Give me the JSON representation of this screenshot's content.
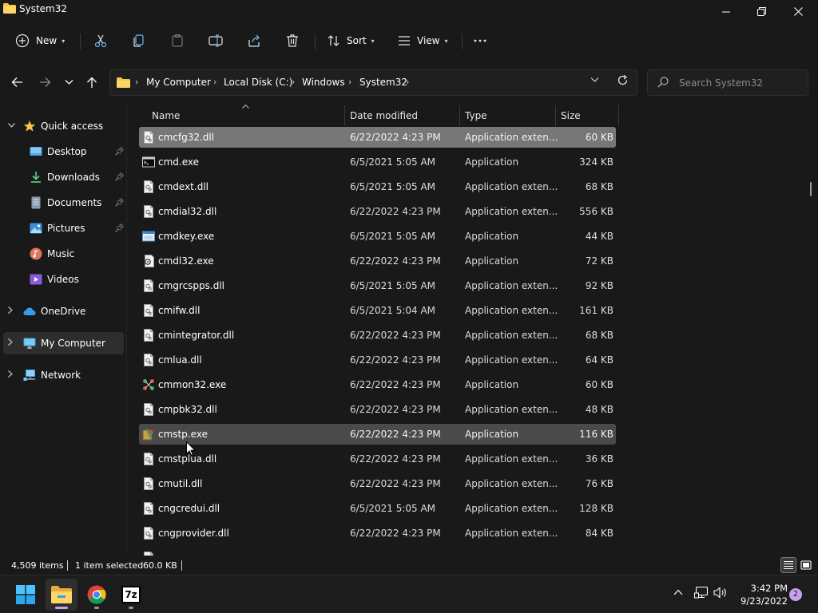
{
  "window": {
    "title": "System32",
    "minimize_icon": "minimize-icon",
    "restore_icon": "restore-icon",
    "close_icon": "close-icon"
  },
  "commandbar": {
    "new_label": "New",
    "sort_label": "Sort",
    "view_label": "View"
  },
  "address": {
    "crumbs": [
      "My Computer",
      "Local Disk (C:)",
      "Windows",
      "System32"
    ]
  },
  "search": {
    "placeholder": "Search System32"
  },
  "sidebar": {
    "items": [
      {
        "label": "Quick access",
        "icon": "star-icon"
      },
      {
        "label": "Desktop",
        "icon": "desktop-icon",
        "pinned": true
      },
      {
        "label": "Downloads",
        "icon": "download-icon",
        "pinned": true
      },
      {
        "label": "Documents",
        "icon": "documents-icon",
        "pinned": true
      },
      {
        "label": "Pictures",
        "icon": "pictures-icon",
        "pinned": true
      },
      {
        "label": "Music",
        "icon": "music-icon"
      },
      {
        "label": "Videos",
        "icon": "videos-icon"
      },
      {
        "label": "OneDrive",
        "icon": "cloud-icon"
      },
      {
        "label": "My Computer",
        "icon": "computer-icon",
        "selected": true
      },
      {
        "label": "Network",
        "icon": "network-icon"
      }
    ]
  },
  "columns": {
    "name": "Name",
    "date": "Date modified",
    "type": "Type",
    "size": "Size"
  },
  "files": [
    {
      "name": "cmcfg32.dll",
      "date": "6/22/2022 4:23 PM",
      "type": "Application exten...",
      "size": "60 KB",
      "icon": "dll-icon"
    },
    {
      "name": "cmd.exe",
      "date": "6/5/2021 5:05 AM",
      "type": "Application",
      "size": "324 KB",
      "icon": "console-icon"
    },
    {
      "name": "cmdext.dll",
      "date": "6/5/2021 5:05 AM",
      "type": "Application exten...",
      "size": "68 KB",
      "icon": "dll-icon"
    },
    {
      "name": "cmdial32.dll",
      "date": "6/22/2022 4:23 PM",
      "type": "Application exten...",
      "size": "556 KB",
      "icon": "dll-icon"
    },
    {
      "name": "cmdkey.exe",
      "date": "6/5/2021 5:05 AM",
      "type": "Application",
      "size": "44 KB",
      "icon": "app-window-icon"
    },
    {
      "name": "cmdl32.exe",
      "date": "6/22/2022 4:23 PM",
      "type": "Application",
      "size": "72 KB",
      "icon": "gear-doc-icon"
    },
    {
      "name": "cmgrcspps.dll",
      "date": "6/5/2021 5:05 AM",
      "type": "Application exten...",
      "size": "92 KB",
      "icon": "dll-icon"
    },
    {
      "name": "cmifw.dll",
      "date": "6/5/2021 5:04 AM",
      "type": "Application exten...",
      "size": "161 KB",
      "icon": "dll-icon"
    },
    {
      "name": "cmintegrator.dll",
      "date": "6/22/2022 4:23 PM",
      "type": "Application exten...",
      "size": "68 KB",
      "icon": "dll-icon"
    },
    {
      "name": "cmlua.dll",
      "date": "6/22/2022 4:23 PM",
      "type": "Application exten...",
      "size": "64 KB",
      "icon": "dll-icon"
    },
    {
      "name": "cmmon32.exe",
      "date": "6/22/2022 4:23 PM",
      "type": "Application",
      "size": "60 KB",
      "icon": "network-app-icon"
    },
    {
      "name": "cmpbk32.dll",
      "date": "6/22/2022 4:23 PM",
      "type": "Application exten...",
      "size": "48 KB",
      "icon": "dll-icon"
    },
    {
      "name": "cmstp.exe",
      "date": "6/22/2022 4:23 PM",
      "type": "Application",
      "size": "116 KB",
      "icon": "setup-app-icon"
    },
    {
      "name": "cmstplua.dll",
      "date": "6/22/2022 4:23 PM",
      "type": "Application exten...",
      "size": "36 KB",
      "icon": "dll-icon"
    },
    {
      "name": "cmutil.dll",
      "date": "6/22/2022 4:23 PM",
      "type": "Application exten...",
      "size": "76 KB",
      "icon": "dll-icon"
    },
    {
      "name": "cngcredui.dll",
      "date": "6/5/2021 5:05 AM",
      "type": "Application exten...",
      "size": "128 KB",
      "icon": "dll-icon"
    },
    {
      "name": "cngprovider.dll",
      "date": "6/22/2022 4:23 PM",
      "type": "Application exten...",
      "size": "84 KB",
      "icon": "dll-icon"
    }
  ],
  "status": {
    "item_count": "4,509 items",
    "selection": "1 item selected",
    "selection_size": "60.0 KB"
  },
  "taskbar": {
    "time": "3:42 PM",
    "date": "9/23/2022",
    "notification_count": "2",
    "apps": [
      "start-icon",
      "file-explorer-icon",
      "chrome-icon",
      "7zip-icon"
    ],
    "sevenzip_label": "7z"
  },
  "colors": {
    "selected_row": "#777777",
    "hover_row": "#4a4a4a",
    "folder": "#f7c548",
    "accent": "#4cc2ff"
  }
}
